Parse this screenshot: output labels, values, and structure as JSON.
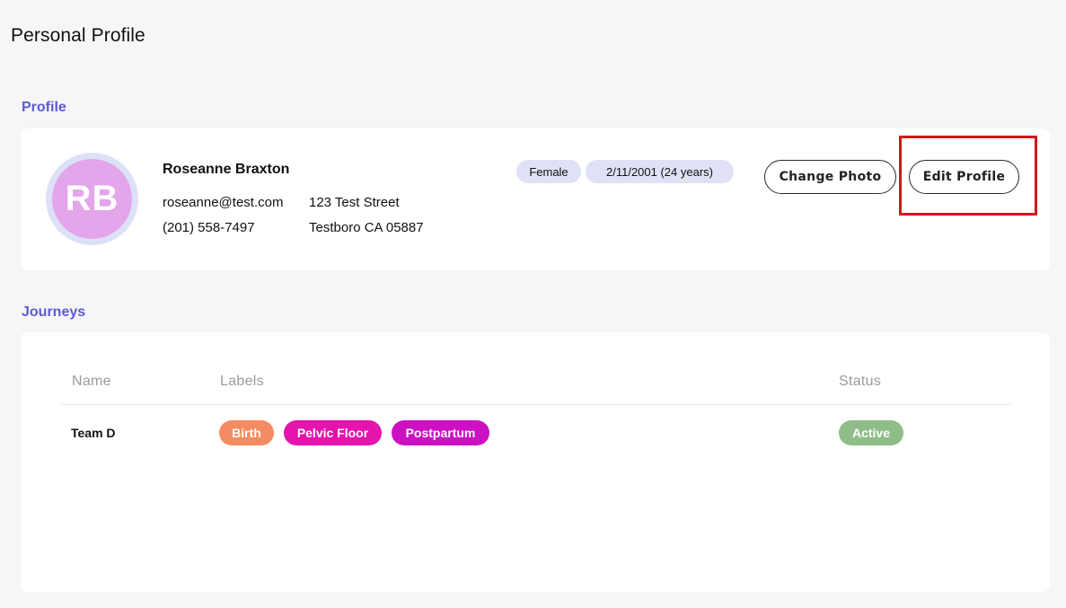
{
  "page": {
    "title": "Personal Profile"
  },
  "profile_section": {
    "label": "Profile",
    "avatar_initials": "RB",
    "name": "Roseanne Braxton",
    "email": "roseanne@test.com",
    "phone": "(201) 558-7497",
    "address_line1": "123 Test Street",
    "address_line2": "Testboro CA 05887",
    "gender": "Female",
    "dob": "2/11/2001 (24 years)",
    "change_photo_label": "Change Photo",
    "edit_profile_label": "Edit Profile"
  },
  "journeys_section": {
    "label": "Journeys",
    "columns": [
      "Name",
      "Labels",
      "Status"
    ],
    "rows": [
      {
        "name": "Team D",
        "labels": [
          "Birth",
          "Pelvic Floor",
          "Postpartum"
        ],
        "status": "Active"
      }
    ]
  },
  "colors": {
    "accent": "#5b5bd6",
    "avatar_ring": "#dde1f7",
    "avatar_fill": "#e3a6ea",
    "tag_bg": "#dfe1f6",
    "label_birth": "#f58b62",
    "label_pelvic_floor": "#e315ac",
    "label_postpartum": "#cc11c3",
    "status_active": "#8fbd88",
    "highlight": "#d9131c"
  }
}
